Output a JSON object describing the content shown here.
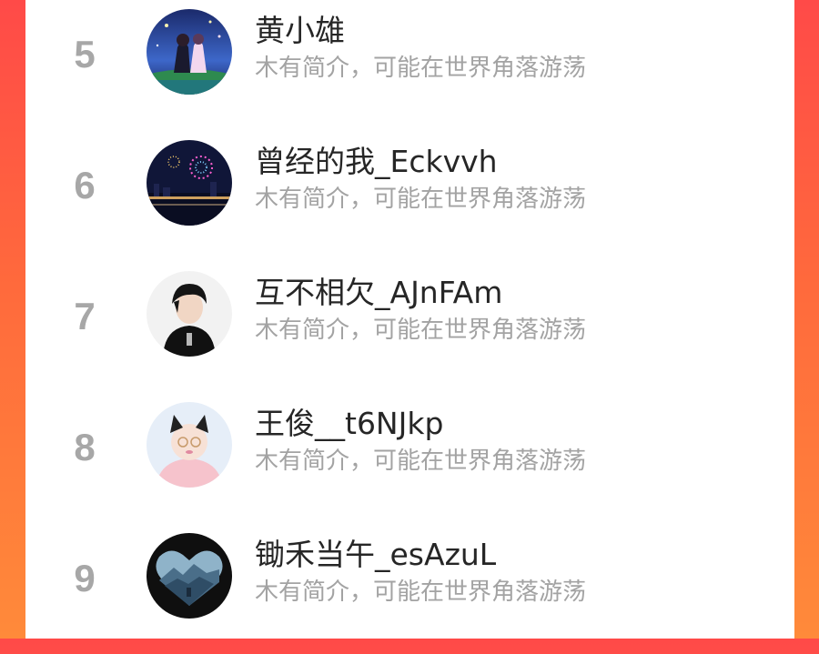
{
  "users": [
    {
      "rank": "5",
      "name": "黄小雄",
      "bio": "木有简介，可能在世界角落游荡",
      "avatar_icon": "anime-couple-night-avatar-icon"
    },
    {
      "rank": "6",
      "name": "曾经的我_Eckvvh",
      "bio": "木有简介，可能在世界角落游荡",
      "avatar_icon": "city-fireworks-avatar-icon"
    },
    {
      "rank": "7",
      "name": "互不相欠_AJnFAm",
      "bio": "木有简介，可能在世界角落游荡",
      "avatar_icon": "boy-portrait-avatar-icon"
    },
    {
      "rank": "8",
      "name": "王俊__t6NJkp",
      "bio": "木有简介，可能在世界角落游荡",
      "avatar_icon": "baby-cat-ears-avatar-icon"
    },
    {
      "rank": "9",
      "name": "锄禾当午_esAzuL",
      "bio": "木有简介，可能在世界角落游荡",
      "avatar_icon": "heart-mountain-avatar-icon"
    }
  ],
  "colors": {
    "background_gradient_top": "#ff4a48",
    "background_gradient_bottom": "#ff8a3a",
    "panel": "#ffffff",
    "rank_text": "#a7a7a7",
    "name_text": "#262626",
    "bio_text": "#a3a3a3"
  }
}
